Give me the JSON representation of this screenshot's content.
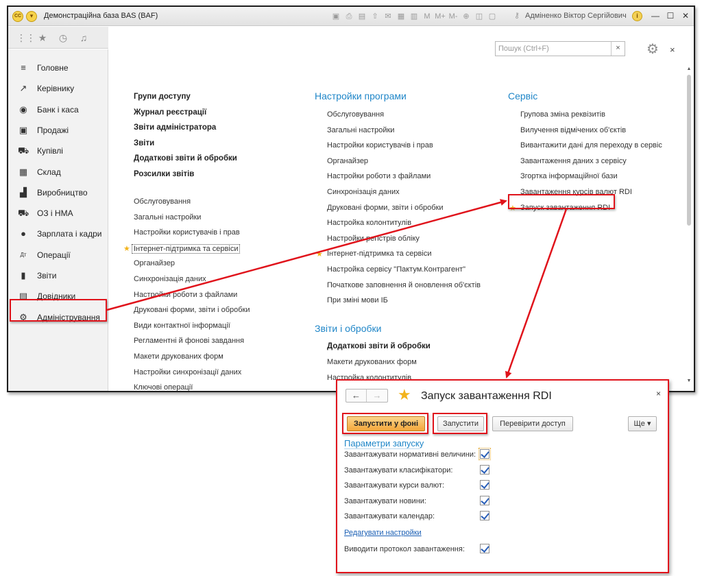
{
  "window": {
    "title": "Демонстраційна база BAS  (BAF)",
    "logo_text": "СС",
    "user": "Адміненко Віктор Сергійович"
  },
  "sidebar": {
    "items": [
      {
        "label": "Головне",
        "icon": "≡"
      },
      {
        "label": "Керівнику",
        "icon": "↗"
      },
      {
        "label": "Банк і каса",
        "icon": "◉"
      },
      {
        "label": "Продажі",
        "icon": "▣"
      },
      {
        "label": "Купівлі",
        "icon": "⛟"
      },
      {
        "label": "Склад",
        "icon": "▦"
      },
      {
        "label": "Виробництво",
        "icon": "▟"
      },
      {
        "label": "ОЗ і НМА",
        "icon": "⛟"
      },
      {
        "label": "Зарплата і кадри",
        "icon": "●"
      },
      {
        "label": "Операції",
        "icon": "Дт"
      },
      {
        "label": "Звіти",
        "icon": "▮"
      },
      {
        "label": "Довідники",
        "icon": "▤"
      },
      {
        "label": "Адміністрування",
        "icon": "⚙"
      }
    ]
  },
  "search": {
    "placeholder": "Пошук (Ctrl+F)"
  },
  "col1": {
    "bold": [
      "Групи доступу",
      "Журнал реєстрації",
      "Звіти адміністратора",
      "Звіти",
      "Додаткові звіти й обробки",
      "Розсилки звітів"
    ],
    "items": [
      "Обслуговування",
      "Загальні настройки",
      "Настройки користувачів і прав",
      "Інтернет-підтримка та сервіси",
      "Органайзер",
      "Синхронізація даних",
      "Настройки роботи з файлами",
      "Друковані форми, звіти і обробки",
      "Види контактної інформації",
      "Регламентні й фонові завдання",
      "Макети друкованих форм",
      "Настройки синхронізації даних",
      "Ключові операції"
    ]
  },
  "col2": {
    "header": "Настройки програми",
    "items": [
      "Обслуговування",
      "Загальні настройки",
      "Настройки користувачів і прав",
      "Органайзер",
      "Настройки роботи з файлами",
      "Синхронізація даних",
      "Друковані форми, звіти і обробки",
      "Настройка колонтитулів",
      "Настройки регістрів обліку",
      "Інтернет-підтримка та сервіси",
      "Настройка сервісу \"Пактум.Контрагент\"",
      "Початкове заповнення й оновлення об'єктів",
      "При зміні мови ІБ"
    ],
    "header2": "Звіти і обробки",
    "items2_bold": "Додаткові звіти й обробки",
    "items2": [
      "Макети друкованих форм",
      "Настройка колонтитулів"
    ]
  },
  "col3": {
    "header": "Сервіс",
    "items": [
      "Групова зміна реквізитів",
      "Вилучення відмічених об'єктів",
      "Вивантажити дані для переходу в сервіс",
      "Завантаження даних з сервісу",
      "Згортка інформаційної бази",
      "Завантаження курсів валют RDI",
      "Запуск завантаження RDI"
    ]
  },
  "dialog": {
    "title": "Запуск завантаження RDI",
    "btn_run_bg": "Запустити у фоні",
    "btn_run": "Запустити",
    "btn_check": "Перевірити доступ",
    "btn_more": "Ще ▾",
    "section": "Параметри запуску",
    "options": [
      {
        "label": "Завантажувати нормативні величини:",
        "checked": true
      },
      {
        "label": "Завантажувати класифікатори:",
        "checked": true
      },
      {
        "label": "Завантажувати курси валют:",
        "checked": true
      },
      {
        "label": "Завантажувати новини:",
        "checked": true
      },
      {
        "label": "Завантажувати календар:",
        "checked": true
      }
    ],
    "edit_link": "Редагувати настройки",
    "log_label": "Виводити протокол завантаження:",
    "log_checked": true
  },
  "colors": {
    "accent": "#1f86c8",
    "highlight": "#e0131b",
    "star": "#f2b31b"
  }
}
